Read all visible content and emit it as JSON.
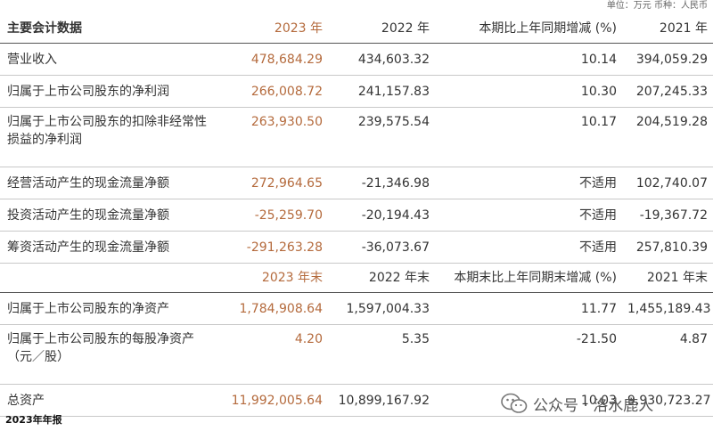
{
  "unit_note": "单位：万元 币种：人民币",
  "header1": [
    "主要会计数据",
    "2023 年",
    "2022 年",
    "本期比上年同期增减 (%)",
    "2021 年"
  ],
  "rows1": [
    {
      "label": "营业收入",
      "v2023": "478,684.29",
      "v2022": "434,603.32",
      "change": "10.14",
      "v2021": "394,059.29"
    },
    {
      "label": "归属于上市公司股东的净利润",
      "v2023": "266,008.72",
      "v2022": "241,157.83",
      "change": "10.30",
      "v2021": "207,245.33"
    },
    {
      "label": "归属于上市公司股东的扣除非经常性损益的净利润",
      "v2023": "263,930.50",
      "v2022": "239,575.54",
      "change": "10.17",
      "v2021": "204,519.28"
    },
    {
      "label": "经营活动产生的现金流量净额",
      "v2023": "272,964.65",
      "v2022": "-21,346.98",
      "change": "不适用",
      "v2021": "102,740.07"
    },
    {
      "label": "投资活动产生的现金流量净额",
      "v2023": "-25,259.70",
      "v2022": "-20,194.43",
      "change": "不适用",
      "v2021": "-19,367.72"
    },
    {
      "label": "筹资活动产生的现金流量净额",
      "v2023": "-291,263.28",
      "v2022": "-36,073.67",
      "change": "不适用",
      "v2021": "257,810.39"
    }
  ],
  "header2": [
    "",
    "2023 年末",
    "2022 年末",
    "本期末比上年同期末增减 (%)",
    "2021 年末"
  ],
  "rows2": [
    {
      "label": "归属于上市公司股东的净资产",
      "v2023": "1,784,908.64",
      "v2022": "1,597,004.33",
      "change": "11.77",
      "v2021": "1,455,189.43"
    },
    {
      "label": "归属于上市公司股东的每股净资产（元／股）",
      "v2023": "4.20",
      "v2022": "5.35",
      "change": "-21.50",
      "v2021": "4.87"
    },
    {
      "label": "总资产",
      "v2023": "11,992,005.64",
      "v2022": "10,899,167.92",
      "change": "10.03",
      "v2021": "9,930,723.27"
    }
  ],
  "footer": "2023年年报",
  "watermark": "公众号 · 洛水鹿人",
  "colors": {
    "accent": "#b46a3c",
    "text": "#333333",
    "rule": "#555555"
  }
}
